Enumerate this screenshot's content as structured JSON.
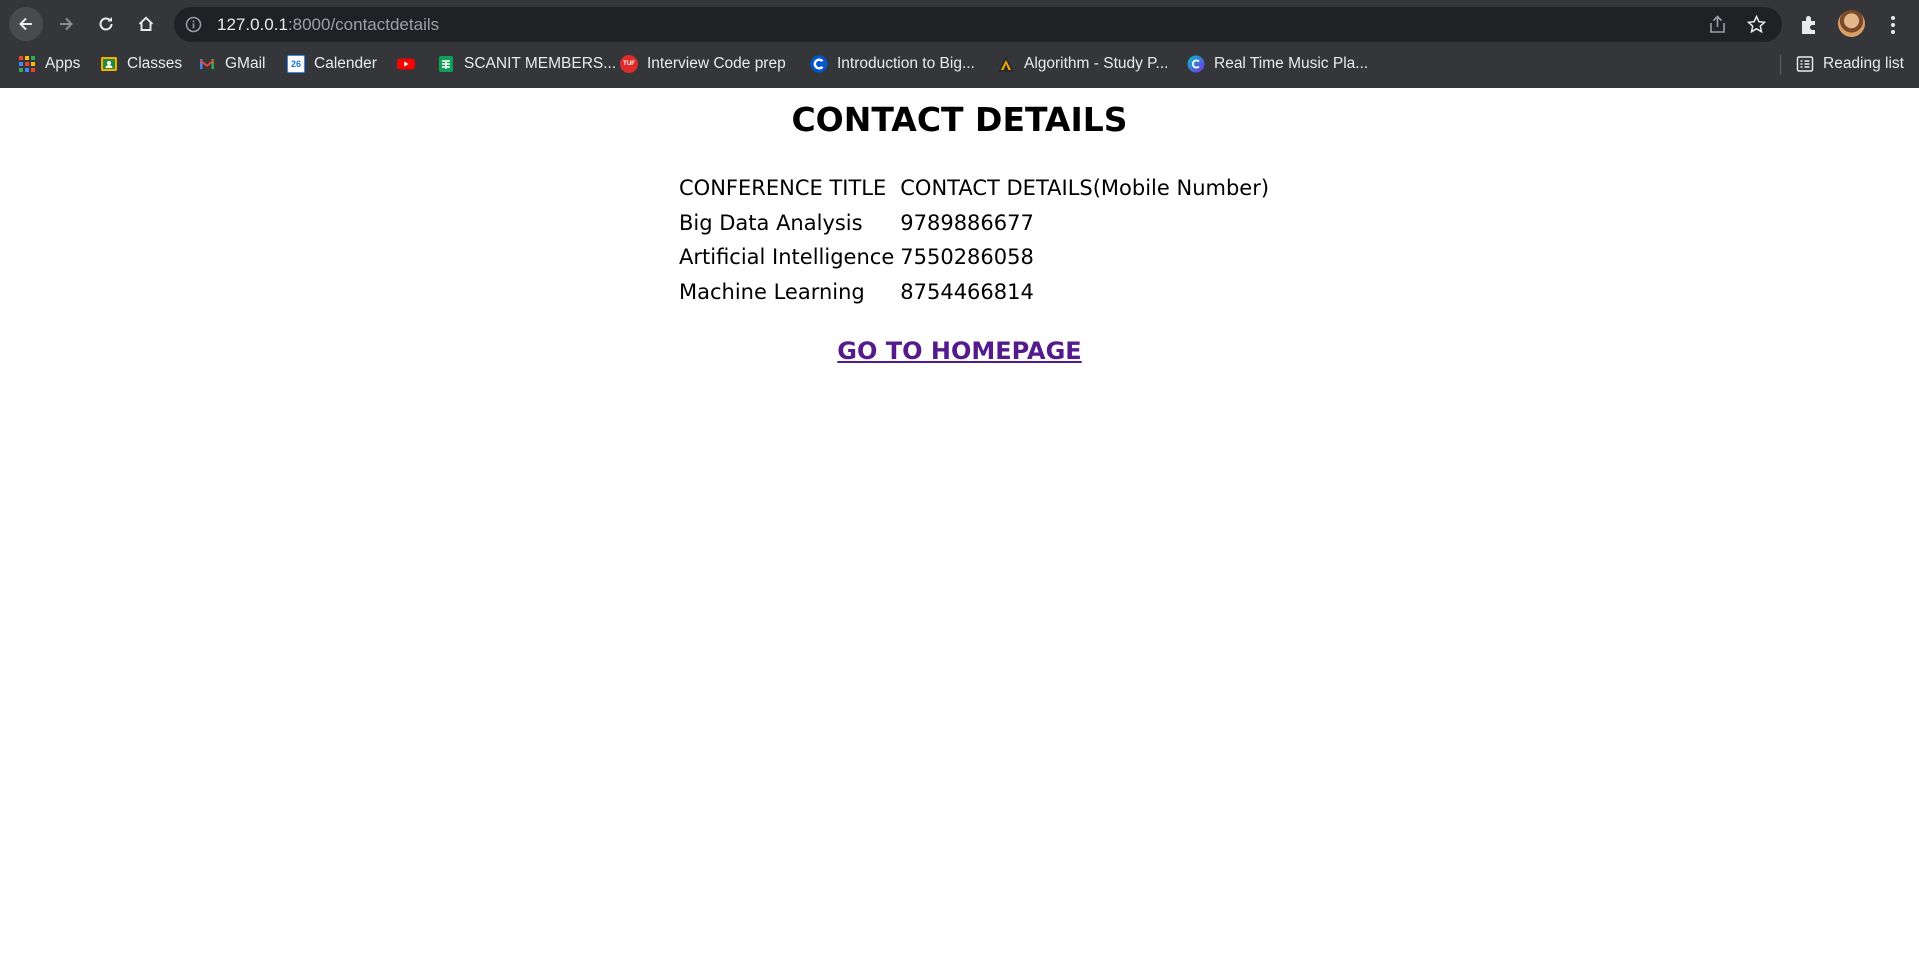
{
  "browser": {
    "url_host": "127.0.0.1",
    "url_path": ":8000/contactdetails",
    "reading_list_label": "Reading list",
    "bookmarks": [
      {
        "label": "Apps",
        "icon": "apps-grid-icon"
      },
      {
        "label": "Classes",
        "icon": "classroom-icon"
      },
      {
        "label": "GMail",
        "icon": "gmail-icon"
      },
      {
        "label": "Calender",
        "icon": "calendar-icon"
      },
      {
        "label": "",
        "icon": "youtube-icon"
      },
      {
        "label": "SCANIT MEMBERS...",
        "icon": "sheets-icon"
      },
      {
        "label": "Interview Code prep",
        "icon": "tuf-icon"
      },
      {
        "label": "Introduction to Big...",
        "icon": "coursera-icon"
      },
      {
        "label": "Algorithm - Study P...",
        "icon": "algorithm-icon"
      },
      {
        "label": "Real Time Music Pla...",
        "icon": "canva-icon"
      }
    ],
    "calendar_day": "26",
    "tuf_badge": "TUF"
  },
  "page": {
    "title": "CONTACT DETAILS",
    "table": {
      "headers": [
        "CONFERENCE TITLE",
        "CONTACT DETAILS(Mobile Number)"
      ],
      "rows": [
        [
          "Big Data Analysis",
          "9789886677"
        ],
        [
          "Artificial Intelligence",
          "7550286058"
        ],
        [
          "Machine Learning",
          "8754466814"
        ]
      ]
    },
    "home_link": "GO TO HOMEPAGE"
  }
}
